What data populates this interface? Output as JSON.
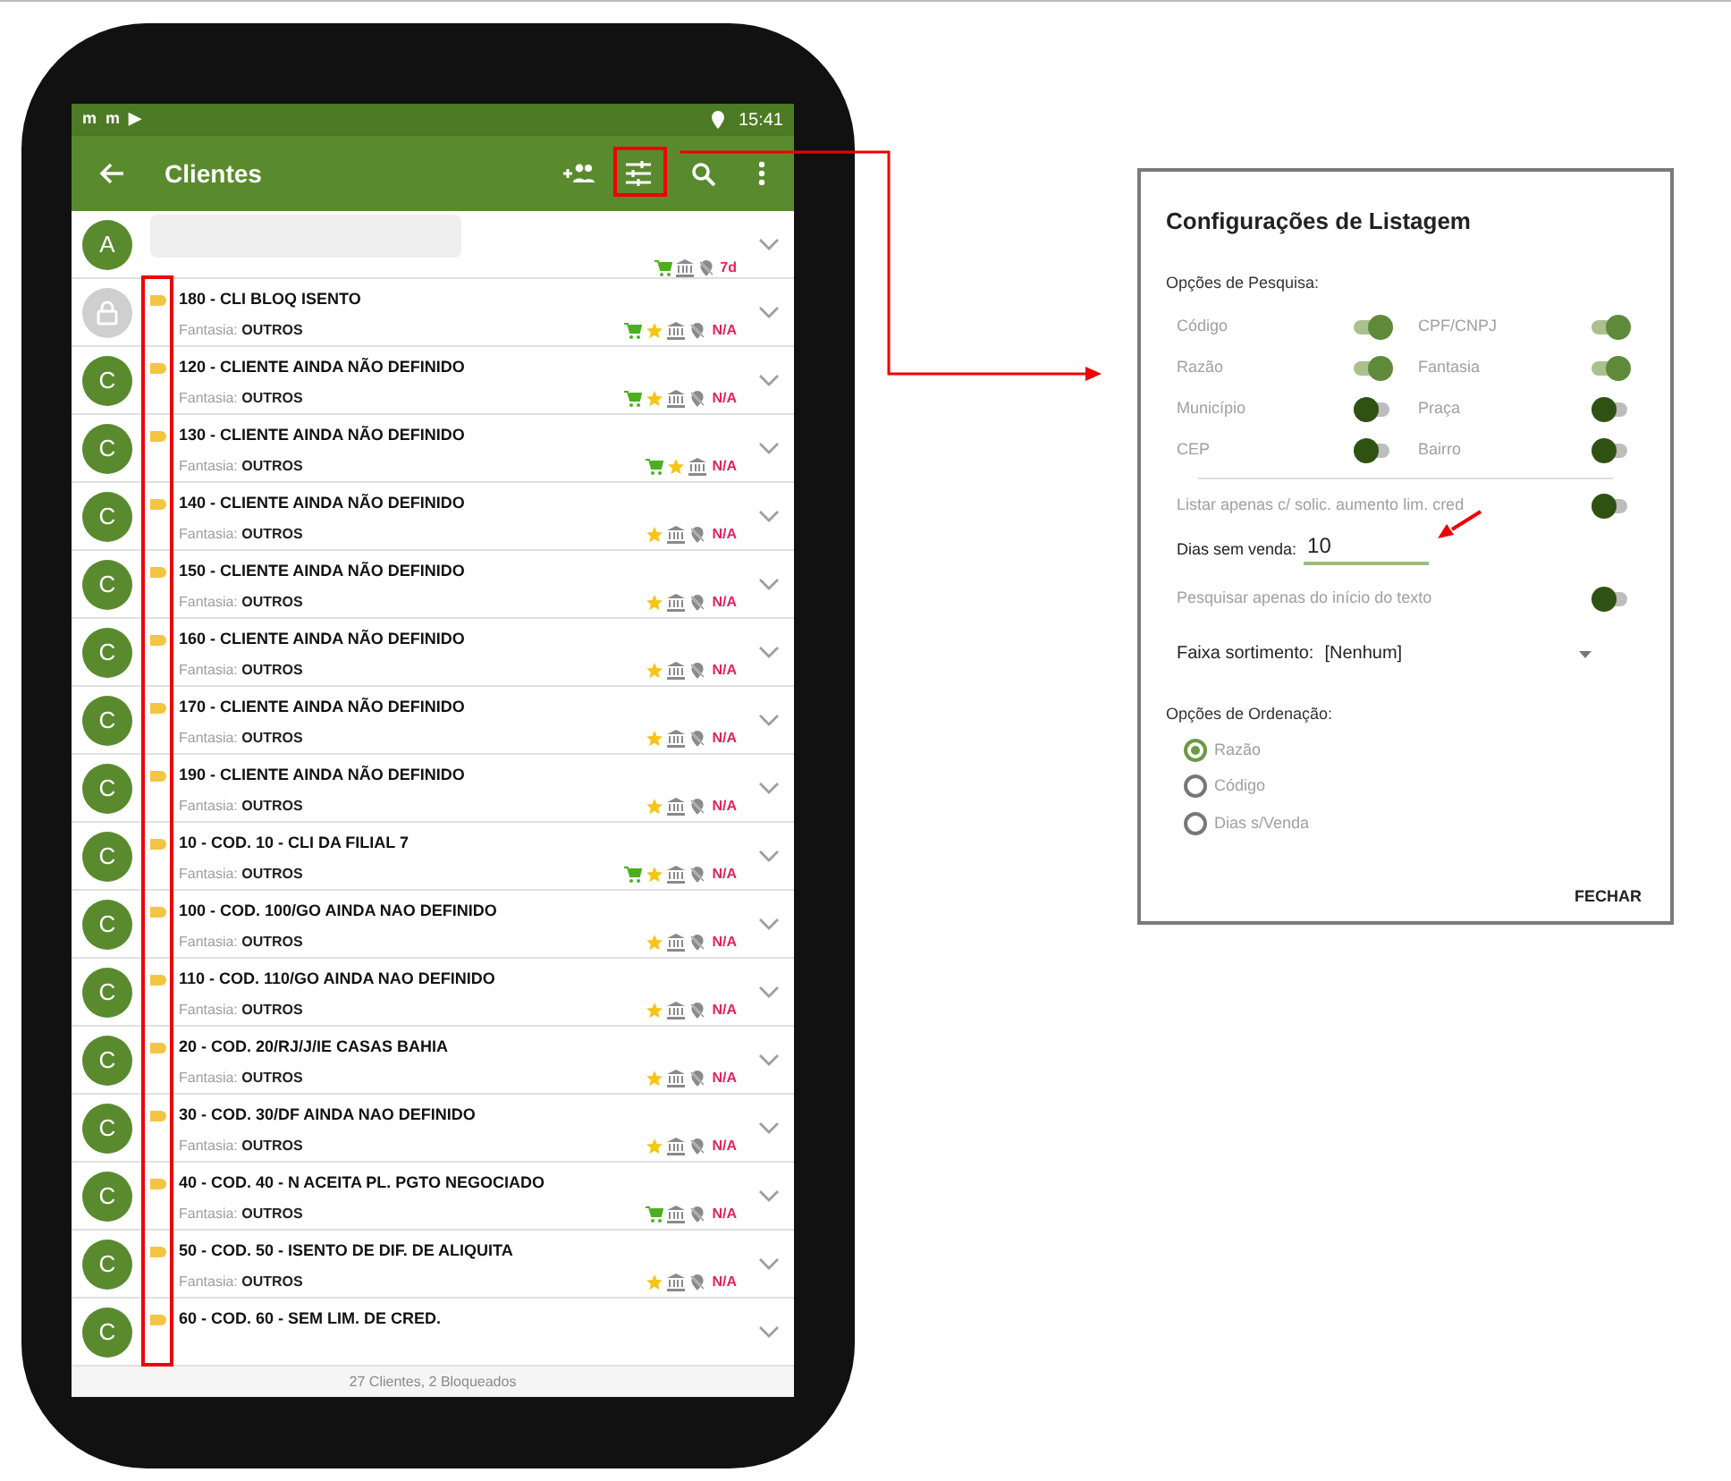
{
  "status_bar": {
    "left_icons": [
      "m",
      "m",
      "▶"
    ],
    "time": "15:41"
  },
  "app_bar": {
    "title": "Clientes"
  },
  "clients": [
    {
      "avatar": "A",
      "kind": "redacted",
      "locked": false,
      "cart": true,
      "star": false,
      "pin": true,
      "badge": "7d"
    },
    {
      "kind": "normal",
      "locked": true,
      "title": "180 - CLI BLOQ ISENTO",
      "fantasia_label": "Fantasia:",
      "fantasia": "OUTROS",
      "cart": true,
      "star": true,
      "pin": true,
      "badge": "N/A"
    },
    {
      "avatar": "C",
      "kind": "normal",
      "locked": false,
      "title": "120 - CLIENTE AINDA NÃO DEFINIDO",
      "fantasia_label": "Fantasia:",
      "fantasia": "OUTROS",
      "cart": true,
      "star": true,
      "pin": true,
      "badge": "N/A"
    },
    {
      "avatar": "C",
      "kind": "normal",
      "locked": false,
      "title": "130 - CLIENTE AINDA NÃO DEFINIDO",
      "fantasia_label": "Fantasia:",
      "fantasia": "OUTROS",
      "cart": true,
      "star": true,
      "pin": false,
      "badge": "N/A"
    },
    {
      "avatar": "C",
      "kind": "normal",
      "locked": false,
      "title": "140 - CLIENTE AINDA NÃO DEFINIDO",
      "fantasia_label": "Fantasia:",
      "fantasia": "OUTROS",
      "cart": false,
      "star": true,
      "pin": true,
      "badge": "N/A"
    },
    {
      "avatar": "C",
      "kind": "normal",
      "locked": false,
      "title": "150 - CLIENTE AINDA NÃO DEFINIDO",
      "fantasia_label": "Fantasia:",
      "fantasia": "OUTROS",
      "cart": false,
      "star": true,
      "pin": true,
      "badge": "N/A"
    },
    {
      "avatar": "C",
      "kind": "normal",
      "locked": false,
      "title": "160 - CLIENTE AINDA NÃO DEFINIDO",
      "fantasia_label": "Fantasia:",
      "fantasia": "OUTROS",
      "cart": false,
      "star": true,
      "pin": true,
      "badge": "N/A"
    },
    {
      "avatar": "C",
      "kind": "normal",
      "locked": false,
      "title": "170 - CLIENTE AINDA NÃO DEFINIDO",
      "fantasia_label": "Fantasia:",
      "fantasia": "OUTROS",
      "cart": false,
      "star": true,
      "pin": true,
      "badge": "N/A"
    },
    {
      "avatar": "C",
      "kind": "normal",
      "locked": false,
      "title": "190 - CLIENTE AINDA NÃO DEFINIDO",
      "fantasia_label": "Fantasia:",
      "fantasia": "OUTROS",
      "cart": false,
      "star": true,
      "pin": true,
      "badge": "N/A"
    },
    {
      "avatar": "C",
      "kind": "normal",
      "locked": false,
      "title": "10 - COD. 10 - CLI DA FILIAL 7",
      "fantasia_label": "Fantasia:",
      "fantasia": "OUTROS",
      "cart": true,
      "star": true,
      "pin": true,
      "badge": "N/A"
    },
    {
      "avatar": "C",
      "kind": "normal",
      "locked": false,
      "title": "100 - COD. 100/GO AINDA NAO DEFINIDO",
      "fantasia_label": "Fantasia:",
      "fantasia": "OUTROS",
      "cart": false,
      "star": true,
      "pin": true,
      "badge": "N/A"
    },
    {
      "avatar": "C",
      "kind": "normal",
      "locked": false,
      "title": "110 - COD. 110/GO AINDA NAO DEFINIDO",
      "fantasia_label": "Fantasia:",
      "fantasia": "OUTROS",
      "cart": false,
      "star": true,
      "pin": true,
      "badge": "N/A"
    },
    {
      "avatar": "C",
      "kind": "normal",
      "locked": false,
      "title": "20 - COD. 20/RJ/J/IE CASAS BAHIA",
      "fantasia_label": "Fantasia:",
      "fantasia": "OUTROS",
      "cart": false,
      "star": true,
      "pin": true,
      "badge": "N/A"
    },
    {
      "avatar": "C",
      "kind": "normal",
      "locked": false,
      "title": "30 - COD. 30/DF AINDA NAO DEFINIDO",
      "fantasia_label": "Fantasia:",
      "fantasia": "OUTROS",
      "cart": false,
      "star": true,
      "pin": true,
      "badge": "N/A"
    },
    {
      "avatar": "C",
      "kind": "normal",
      "locked": false,
      "title": "40 - COD. 40 - N ACEITA PL. PGTO NEGOCIADO",
      "fantasia_label": "Fantasia:",
      "fantasia": "OUTROS",
      "cart": true,
      "star": false,
      "pin": true,
      "badge": "N/A"
    },
    {
      "avatar": "C",
      "kind": "normal",
      "locked": false,
      "title": "50 - COD. 50 - ISENTO DE DIF. DE ALIQUITA",
      "fantasia_label": "Fantasia:",
      "fantasia": "OUTROS",
      "cart": false,
      "star": true,
      "pin": true,
      "badge": "N/A"
    },
    {
      "avatar": "C",
      "kind": "partial",
      "locked": false,
      "title": "60 - COD. 60 - SEM LIM. DE CRED."
    }
  ],
  "footer": "27 Clientes, 2 Bloqueados",
  "dialog": {
    "title": "Configurações de Listagem",
    "search_heading": "Opções de Pesquisa:",
    "search_options": [
      {
        "label": "Código",
        "on": true
      },
      {
        "label": "CPF/CNPJ",
        "on": true
      },
      {
        "label": "Razão",
        "on": true
      },
      {
        "label": "Fantasia",
        "on": true
      },
      {
        "label": "Município",
        "on": false
      },
      {
        "label": "Praça",
        "on": false
      },
      {
        "label": "CEP",
        "on": false
      },
      {
        "label": "Bairro",
        "on": false
      }
    ],
    "credit_only": {
      "label": "Listar apenas c/ solic. aumento lim. cred",
      "on": false
    },
    "days_label": "Dias sem venda:",
    "days_value": "10",
    "prefix_only": {
      "label": "Pesquisar apenas do início do texto",
      "on": false
    },
    "range_label": "Faixa sortimento:",
    "range_value": "[Nenhum]",
    "order_heading": "Opções de Ordenação:",
    "order_options": [
      {
        "label": "Razão",
        "selected": true
      },
      {
        "label": "Código",
        "selected": false
      },
      {
        "label": "Dias s/Venda",
        "selected": false
      }
    ],
    "close": "FECHAR"
  }
}
